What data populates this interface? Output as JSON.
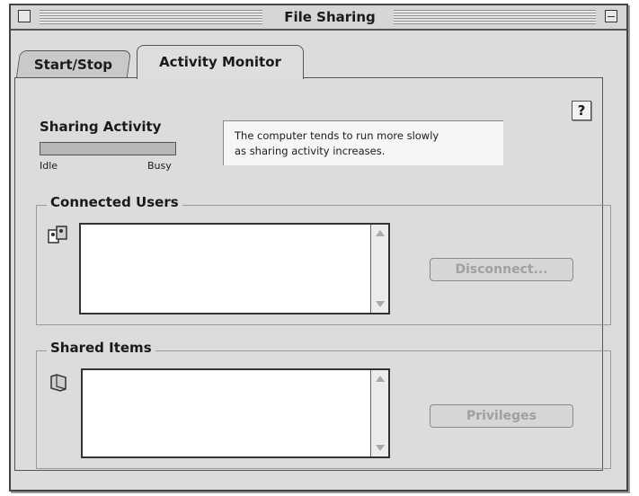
{
  "window": {
    "title": "File Sharing"
  },
  "tabs": [
    {
      "label": "Start/Stop",
      "active": false
    },
    {
      "label": "Activity Monitor",
      "active": true
    }
  ],
  "help_button": {
    "label": "?"
  },
  "sharing_activity": {
    "label": "Sharing Activity",
    "min_label": "Idle",
    "max_label": "Busy",
    "level": 0
  },
  "info_text": {
    "line1": "The computer tends to run more slowly",
    "line2": "as sharing activity increases."
  },
  "connected_users": {
    "label": "Connected Users",
    "items": [],
    "button_label": "Disconnect..."
  },
  "shared_items": {
    "label": "Shared Items",
    "items": [],
    "button_label": "Privileges"
  },
  "icons": [
    "users-icon",
    "folder-icon",
    "help-icon"
  ],
  "colors": {
    "window_bg": "#dcdcdc",
    "meter_fill": "#8a8a8a",
    "disabled_text": "#a0a0a0"
  }
}
